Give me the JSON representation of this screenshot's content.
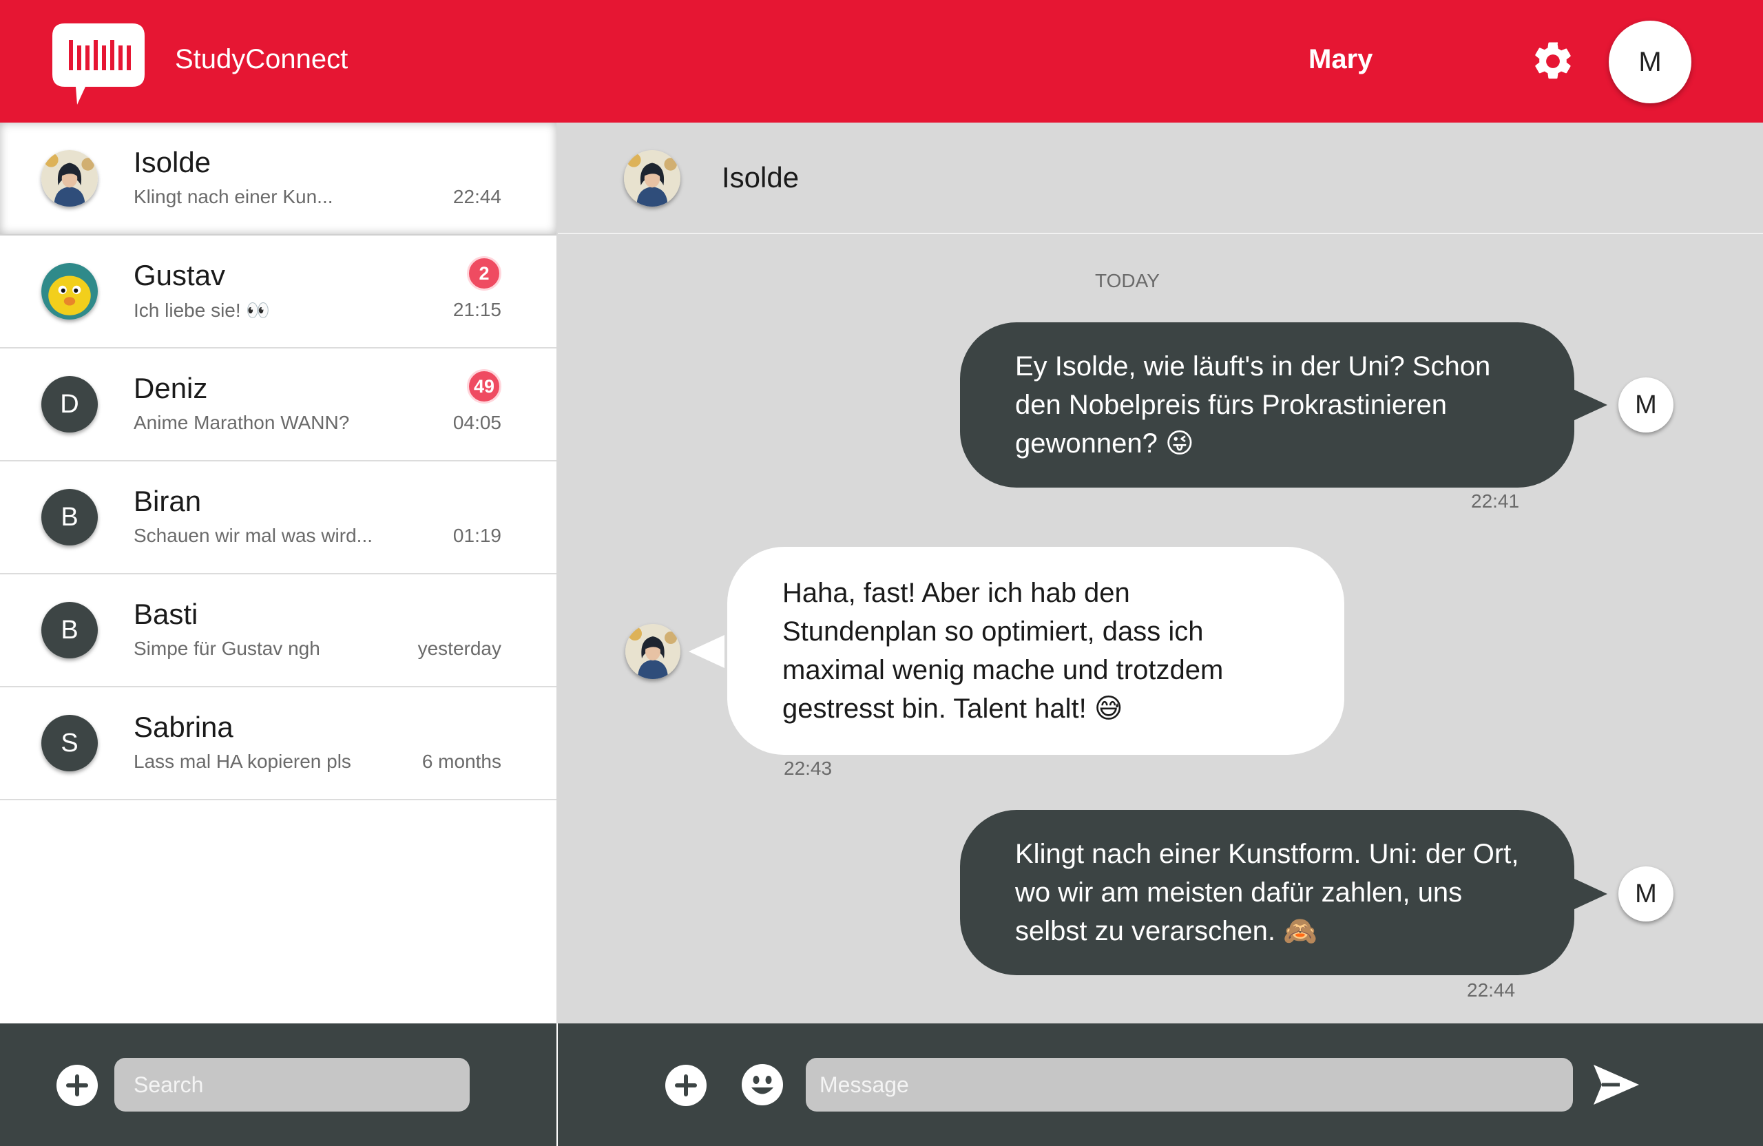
{
  "app": {
    "title": "StudyConnect"
  },
  "header": {
    "user_name": "Mary",
    "avatar_initial": "M",
    "settings_icon": "gear-icon"
  },
  "contacts": [
    {
      "name": "Isolde",
      "preview": "Klingt nach einer Kun...",
      "time": "22:44",
      "avatar": "photo",
      "active": true
    },
    {
      "name": "Gustav",
      "preview": "Ich liebe sie! 👀",
      "time": "21:15",
      "badge": "2",
      "avatar": "duck"
    },
    {
      "name": "Deniz",
      "preview": "Anime Marathon WANN?",
      "time": "04:05",
      "badge": "49",
      "avatar_initial": "D"
    },
    {
      "name": "Biran",
      "preview": "Schauen wir mal was wird...",
      "time": "01:19",
      "avatar_initial": "B"
    },
    {
      "name": "Basti",
      "preview": "Simpe für Gustav ngh",
      "time": "yesterday",
      "avatar_initial": "B"
    },
    {
      "name": "Sabrina",
      "preview": "Lass mal HA kopieren pls",
      "time": "6 months",
      "avatar_initial": "S"
    }
  ],
  "sidebar_footer": {
    "search_placeholder": "Search"
  },
  "chat": {
    "contact_name": "Isolde",
    "date_label": "TODAY",
    "messages": [
      {
        "direction": "out",
        "text": "Ey Isolde, wie läuft's in der Uni? Schon den Nobelpreis fürs Prokrastinieren gewonnen? 😜",
        "time": "22:41",
        "sender_initial": "M"
      },
      {
        "direction": "in",
        "text": "Haha, fast! Aber ich hab den Stundenplan so optimiert, dass ich maximal wenig mache und trotzdem gestresst bin. Talent halt! 😅",
        "time": "22:43"
      },
      {
        "direction": "out",
        "text": "Klingt nach einer Kunstform. Uni: der Ort, wo wir am meisten dafür zahlen, uns selbst zu verarschen. 🙈",
        "time": "22:44",
        "sender_initial": "M"
      }
    ]
  },
  "chat_footer": {
    "message_placeholder": "Message"
  },
  "colors": {
    "brand": "#e61633",
    "dark": "#3c4444",
    "badge": "#ef4b61",
    "panel": "#d9d9d9"
  }
}
